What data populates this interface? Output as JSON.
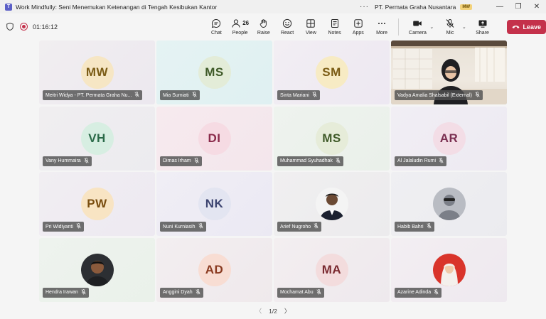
{
  "window": {
    "title": "Work Mindfully: Seni Menemukan Ketenangan di Tengah Kesibukan Kantor",
    "org": "PT. Permata Graha Nusantara",
    "org_badge": "MW",
    "more": "···",
    "minimize": "—",
    "maximize": "❐",
    "close": "✕"
  },
  "toolbar": {
    "timer": "01:16:12",
    "chat": "Chat",
    "people": "People",
    "people_count": "26",
    "raise": "Raise",
    "react": "React",
    "view": "View",
    "notes": "Notes",
    "apps": "Apps",
    "more": "More",
    "camera": "Camera",
    "mic": "Mic",
    "share": "Share",
    "leave": "Leave",
    "accent": "#c4314b"
  },
  "participants": [
    {
      "initials": "MW",
      "name": "Meitri Widya - PT. Permata Graha Nu...",
      "bg": "#f6e6c4",
      "fg": "#7a5b14",
      "tile": "linear-gradient(135deg,#f1eef0,#ece8ef)"
    },
    {
      "initials": "MS",
      "name": "Mia Sumiati",
      "bg": "#e3ecd8",
      "fg": "#3f5a28",
      "tile": "linear-gradient(135deg,#e5f3f3,#dff0f2)"
    },
    {
      "initials": "SM",
      "name": "Sinta Mariani",
      "bg": "#f7ebc4",
      "fg": "#7a5b14",
      "tile": "linear-gradient(135deg,#f2eef3,#ede8f2)"
    },
    {
      "initials": "",
      "name": "Vadya Amalia Shalsabil (External)",
      "bg": "",
      "fg": "",
      "tile": "video"
    },
    {
      "initials": "VH",
      "name": "Vany Hummaira",
      "bg": "#d7eee2",
      "fg": "#2a6a48",
      "tile": "linear-gradient(135deg,#f0eef0,#ecebef)"
    },
    {
      "initials": "DI",
      "name": "Dimas Irham",
      "bg": "#f6dbe3",
      "fg": "#8a2a4a",
      "tile": "linear-gradient(135deg,#f7eaee,#f3e6ec)"
    },
    {
      "initials": "MS",
      "name": "Muhammad Syuhadhak",
      "bg": "#e6ecd9",
      "fg": "#3f5a28",
      "tile": "linear-gradient(135deg,#eef3ee,#eaf0ea)"
    },
    {
      "initials": "AR",
      "name": "Al Jalaludin Rumi",
      "bg": "#f3dde6",
      "fg": "#7a2e50",
      "tile": "linear-gradient(135deg,#f1eef4,#edeaf2)"
    },
    {
      "initials": "PW",
      "name": "Pri Widiyanti",
      "bg": "#f8e4c3",
      "fg": "#7a4e10",
      "tile": "linear-gradient(135deg,#f1eef2,#ede9f1)"
    },
    {
      "initials": "NK",
      "name": "Nuni Kurniasih",
      "bg": "#e3e5f1",
      "fg": "#3c4470",
      "tile": "linear-gradient(135deg,#f0eef5,#ebe9f3)"
    },
    {
      "initials": "",
      "name": "Arief Nugroho",
      "bg": "",
      "fg": "",
      "tile": "linear-gradient(135deg,#f0eff0,#ecebed)",
      "photo": "man"
    },
    {
      "initials": "",
      "name": "Habib Bahri",
      "bg": "",
      "fg": "",
      "tile": "linear-gradient(135deg,#efeff2,#ebebef)",
      "photo": "default"
    },
    {
      "initials": "",
      "name": "Hendra Irawan",
      "bg": "",
      "fg": "",
      "tile": "linear-gradient(135deg,#eef3ee,#eaf1ea)",
      "photo": "dark"
    },
    {
      "initials": "AD",
      "name": "Anggini Dyah",
      "bg": "#f8ddd3",
      "fg": "#8a3a20",
      "tile": "linear-gradient(135deg,#f3eef0,#efe9ec)"
    },
    {
      "initials": "MA",
      "name": "Mochamat Abu",
      "bg": "#f3dcdd",
      "fg": "#7a2a30",
      "tile": "linear-gradient(135deg,#f3eef0,#eee9ed)"
    },
    {
      "initials": "",
      "name": "Azarine Adinda",
      "bg": "",
      "fg": "",
      "tile": "linear-gradient(135deg,#f3eef2,#eee9ef)",
      "photo": "hijab"
    }
  ],
  "pager": {
    "prev": "〈",
    "label": "1/2",
    "next": "〉"
  }
}
